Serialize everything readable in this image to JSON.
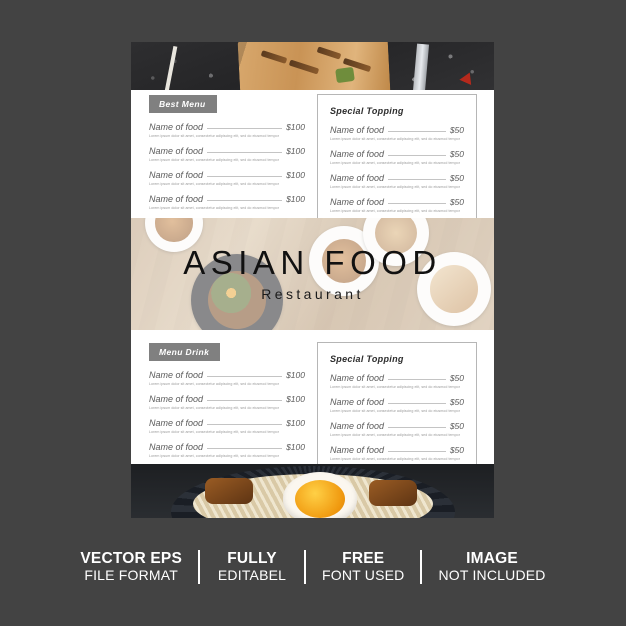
{
  "canvas": {
    "background": "#434343"
  },
  "flyer": {
    "title": "ASIAN FOOD",
    "subtitle": "Restaurant",
    "photos": {
      "top_alt": "dark-table-with-wooden-board-food",
      "center_alt": "asian-dishes-on-wooden-table",
      "bottom_alt": "ramen-bowl-with-soft-boiled-egg"
    },
    "sections": [
      {
        "tag": "Best Menu",
        "items": [
          {
            "name": "Name of food",
            "price": "$100",
            "desc": "Lorem ipsum dolor sit amet, consectetur adipiscing elit, sed do eiusmod tempor"
          },
          {
            "name": "Name of food",
            "price": "$100",
            "desc": "Lorem ipsum dolor sit amet, consectetur adipiscing elit, sed do eiusmod tempor"
          },
          {
            "name": "Name of food",
            "price": "$100",
            "desc": "Lorem ipsum dolor sit amet, consectetur adipiscing elit, sed do eiusmod tempor"
          },
          {
            "name": "Name of food",
            "price": "$100",
            "desc": "Lorem ipsum dolor sit amet, consectetur adipiscing elit, sed do eiusmod tempor"
          }
        ]
      },
      {
        "title": "Special Topping",
        "items": [
          {
            "name": "Name of food",
            "price": "$50",
            "desc": "Lorem ipsum dolor sit amet, consectetur adipiscing elit, sed do eiusmod tempor"
          },
          {
            "name": "Name of food",
            "price": "$50",
            "desc": "Lorem ipsum dolor sit amet, consectetur adipiscing elit, sed do eiusmod tempor"
          },
          {
            "name": "Name of food",
            "price": "$50",
            "desc": "Lorem ipsum dolor sit amet, consectetur adipiscing elit, sed do eiusmod tempor"
          },
          {
            "name": "Name of food",
            "price": "$50",
            "desc": "Lorem ipsum dolor sit amet, consectetur adipiscing elit, sed do eiusmod tempor"
          }
        ]
      },
      {
        "tag": "Menu Drink",
        "items": [
          {
            "name": "Name of food",
            "price": "$100",
            "desc": "Lorem ipsum dolor sit amet, consectetur adipiscing elit, sed do eiusmod tempor"
          },
          {
            "name": "Name of food",
            "price": "$100",
            "desc": "Lorem ipsum dolor sit amet, consectetur adipiscing elit, sed do eiusmod tempor"
          },
          {
            "name": "Name of food",
            "price": "$100",
            "desc": "Lorem ipsum dolor sit amet, consectetur adipiscing elit, sed do eiusmod tempor"
          },
          {
            "name": "Name of food",
            "price": "$100",
            "desc": "Lorem ipsum dolor sit amet, consectetur adipiscing elit, sed do eiusmod tempor"
          }
        ]
      },
      {
        "title": "Special Topping",
        "items": [
          {
            "name": "Name of food",
            "price": "$50",
            "desc": "Lorem ipsum dolor sit amet, consectetur adipiscing elit, sed do eiusmod tempor"
          },
          {
            "name": "Name of food",
            "price": "$50",
            "desc": "Lorem ipsum dolor sit amet, consectetur adipiscing elit, sed do eiusmod tempor"
          },
          {
            "name": "Name of food",
            "price": "$50",
            "desc": "Lorem ipsum dolor sit amet, consectetur adipiscing elit, sed do eiusmod tempor"
          },
          {
            "name": "Name of food",
            "price": "$50",
            "desc": "Lorem ipsum dolor sit amet, consectetur adipiscing elit, sed do eiusmod tempor"
          }
        ]
      }
    ]
  },
  "features": [
    {
      "top": "VECTOR EPS",
      "bottom": "FILE FORMAT"
    },
    {
      "top": "FULLY",
      "bottom": "EDITABEL"
    },
    {
      "top": "FREE",
      "bottom": "FONT USED"
    },
    {
      "top": "IMAGE",
      "bottom": "NOT INCLUDED"
    }
  ]
}
